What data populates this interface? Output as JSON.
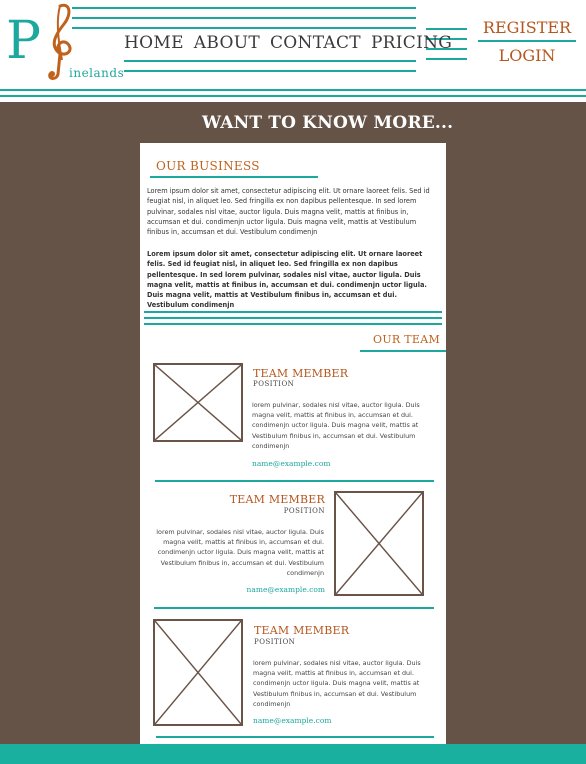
{
  "brand": {
    "logo_letter": "P",
    "name": "inelands"
  },
  "nav": [
    "HOME",
    "ABOUT",
    "CONTACT",
    "PRICING"
  ],
  "account": {
    "register": "REGISTER",
    "login": "LOGIN"
  },
  "hero": {
    "heading": "WANT TO KNOW MORE..."
  },
  "business": {
    "title": "OUR BUSINESS",
    "p1": "Lorem ipsum dolor sit amet, consectetur adipiscing elit. Ut ornare laoreet felis. Sed id feugiat nisl, in aliquet leo. Sed fringilla ex non dapibus pellentesque. In sed lorem pulvinar, sodales nisl vitae, auctor ligula. Duis magna velit, mattis at finibus in, accumsan et dui. condimenjn uctor ligula. Duis magna velit, mattis at Vestibulum finibus in, accumsan et dui. Vestibulum condimenjn",
    "p2": "Lorem ipsum dolor sit amet, consectetur adipiscing elit. Ut ornare laoreet felis. Sed id feugiat nisl, in aliquet leo. Sed fringilla ex non dapibus pellentesque. In sed lorem pulvinar, sodales nisl vitae, auctor ligula. Duis magna velit, mattis at finibus in, accumsan et dui. condimenjn uctor ligula. Duis magna velit, mattis at Vestibulum finibus in, accumsan et dui. Vestibulum condimenjn"
  },
  "team": {
    "title": "OUR TEAM",
    "members": [
      {
        "name": "TEAM MEMBER",
        "position": "POSITION",
        "desc": "lorem pulvinar, sodales nisl vitae, auctor ligula. Duis magna velit, mattis at finibus in, accumsan et dui. condimenjn uctor ligula. Duis magna velit, mattis at Vestibulum finibus in, accumsan et dui. Vestibulum condimenjn",
        "email": "name@example.com"
      },
      {
        "name": "TEAM MEMBER",
        "position": "POSITION",
        "desc": "lorem pulvinar, sodales nisl vitae, auctor ligula. Duis magna velit, mattis at finibus in, accumsan et dui. condimenjn uctor ligula. Duis magna velit, mattis at Vestibulum finibus in, accumsan et dui. Vestibulum condimenjn",
        "email": "name@example.com"
      },
      {
        "name": "TEAM MEMBER",
        "position": "POSITION",
        "desc": "lorem pulvinar, sodales nisl vitae, auctor ligula. Duis magna velit, mattis at finibus in, accumsan et dui. condimenjn uctor ligula. Duis magna velit, mattis at Vestibulum finibus in, accumsan et dui. Vestibulum condimenjn",
        "email": "name@example.com"
      }
    ]
  },
  "colors": {
    "teal": "#1da89e",
    "orange": "#b5561e",
    "brown": "#665348",
    "footer": "#1ab09f"
  }
}
